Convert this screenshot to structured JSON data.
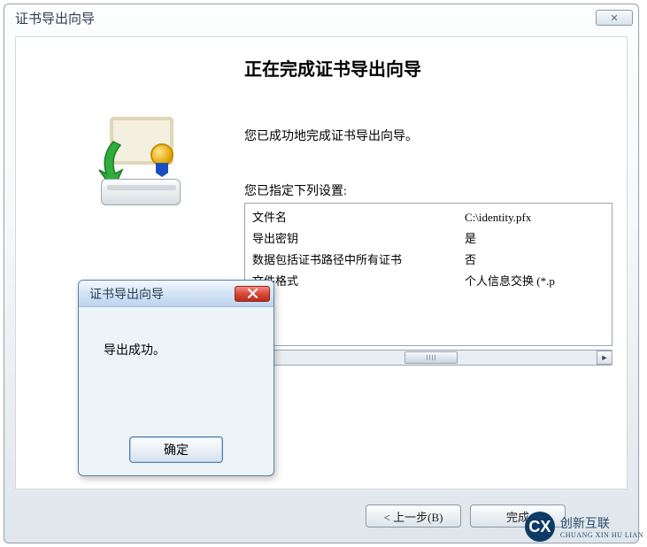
{
  "wizard": {
    "title": "证书导出向导",
    "heading": "正在完成证书导出向导",
    "success_line": "您已成功地完成证书导出向导。",
    "settings_label": "您已指定下列设置:",
    "settings": [
      {
        "key": "文件名",
        "value": "C:\\identity.pfx"
      },
      {
        "key": "导出密钥",
        "value": "是"
      },
      {
        "key": "数据包括证书路径中所有证书",
        "value": "否"
      },
      {
        "key": "文件格式",
        "value": "个人信息交换 (*.p"
      }
    ],
    "buttons": {
      "back": "< 上一步(B)",
      "finish": "完成"
    }
  },
  "dialog": {
    "title": "证书导出向导",
    "message": "导出成功。",
    "ok": "确定"
  },
  "logo": {
    "text": "创新互联",
    "sub": "CHUANG XIN HU LIAN"
  }
}
